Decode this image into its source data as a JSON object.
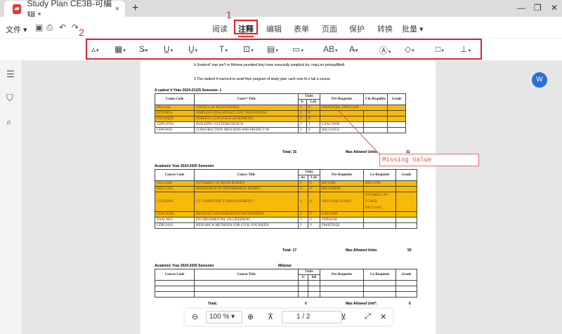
{
  "window": {
    "tab_title": "Study Plan CE3B-可编辑 *",
    "tab_close": "×",
    "new_tab": "+",
    "min": "—",
    "restore": "❐",
    "close": "✕"
  },
  "menu": {
    "file": "文件",
    "tabs": [
      "阅读",
      "注释",
      "编辑",
      "表单",
      "页面",
      "保护",
      "转换",
      "批量"
    ],
    "active_index": 1
  },
  "callouts": {
    "n1": "1",
    "n2": "2"
  },
  "accent_colors": {
    "red_annotation": "#e0212e",
    "highlight": "#f7b90a",
    "missing_value": "#e05555"
  },
  "document": {
    "lines": [
      "b Srwdcnt* mar mn*l m Mnlrear pruvided they have sunvuiully simpklcd du- rvqul.ntr prtrequBileA.",
      "3 The sludent ll rnumrcd to wvisf their program of study plan «ach nme llr«r fail a course"
    ],
    "tables": [
      {
        "heading": "A cadent it Yean 2024-21125 Semester. 1",
        "headers": [
          "Coum Code",
          "Cours* Title",
          "Units",
          "lc",
          "Lab",
          "Pre-Requisite",
          "C&-Reqnilite",
          "Grade"
        ],
        "rows": [
          [
            "HEccoanj",
            "STATICS OF RIGID BODIES",
            "3",
            "0",
            "EMATDQIB, ENPSCQrH",
            ""
          ],
          [
            "ECFOBOa",
            "SIMESOSYEDAlyPEUKCLANC PANLIPUNAb",
            "3",
            "0",
            "",
            ""
          ],
          [
            "FOLAIQOI",
            "FOREIGN LANGUAGE (EUROPEAN)",
            "1",
            "0",
            "",
            ""
          ],
          [
            "CEPCOT03",
            "BUILDING SYSTEMS DESIGN",
            "2",
            "1",
            "LAACOWB",
            ""
          ],
          [
            "CEPOW03",
            "CONSTRUCTION MED KIDS AND PROJECT M",
            "3",
            "0",
            "BECCO5O2",
            ""
          ]
        ],
        "highlight": [
          true,
          true,
          true,
          false,
          false
        ],
        "total": "Total; 15",
        "max": "Max Allowed Units:",
        "max_val": "31"
      },
      {
        "heading": "Academic Year 2024-2025 Semester",
        "headers": [
          "Course Code",
          "Courw Title",
          "Units",
          "tec",
          "l-ab",
          "Pre-Requisite",
          "Co-Requisite",
          "Grade"
        ],
        "rows": [
          [
            "BECCmIB",
            "DYNAMICS OF RIGID BODIES",
            "2",
            "0",
            "BICUMB",
            "BECC1IM"
          ],
          [
            "BECC1104",
            "MECHANICS OF DEFORMABLE BODIES",
            "4",
            "0",
            "BECCOBDB",
            ""
          ],
          [
            "CECED003",
            "CF COMPETENCY ENHANCEMENT 1",
            "3",
            "0",
            "2ND YEAR STAND",
            "ENTSMIJ2, BF-CC0KB, BECC1104"
          ],
          [
            "CEPCOt283",
            "HIGHWAY AND RAILROAD ENGINEERING",
            "3",
            "0",
            "CEPC01M",
            ""
          ],
          [
            "EAACM13",
            "ENVIRONMENTAL ENGINEERING",
            "3",
            "0",
            "FNPS01M",
            ""
          ],
          [
            "CERC0102",
            "RESEARCH METHODS FOR CIVIL ENGINEER:",
            "2",
            "0",
            "FMATD5Q3",
            ""
          ]
        ],
        "highlight": [
          true,
          true,
          true,
          true,
          false,
          false
        ],
        "total": "Total: 17",
        "max": "Max Allowed Units:",
        "max_val": "50"
      },
      {
        "heading": "Academic Year 2024-2025 Semester",
        "heading_right": "Midyear",
        "headers": [
          "Course Code",
          "Course Title",
          "Units",
          "1c",
          "lab",
          "Pre-Requisite",
          "Co-Requisite",
          "Grade"
        ],
        "total": "Total;",
        "total_val": "0",
        "max": "Max Allowed Unit*:",
        "max_val": "6"
      }
    ],
    "annotation": "Missing Value"
  },
  "bottom": {
    "zoom": "100 %",
    "page": "1 / 2"
  }
}
